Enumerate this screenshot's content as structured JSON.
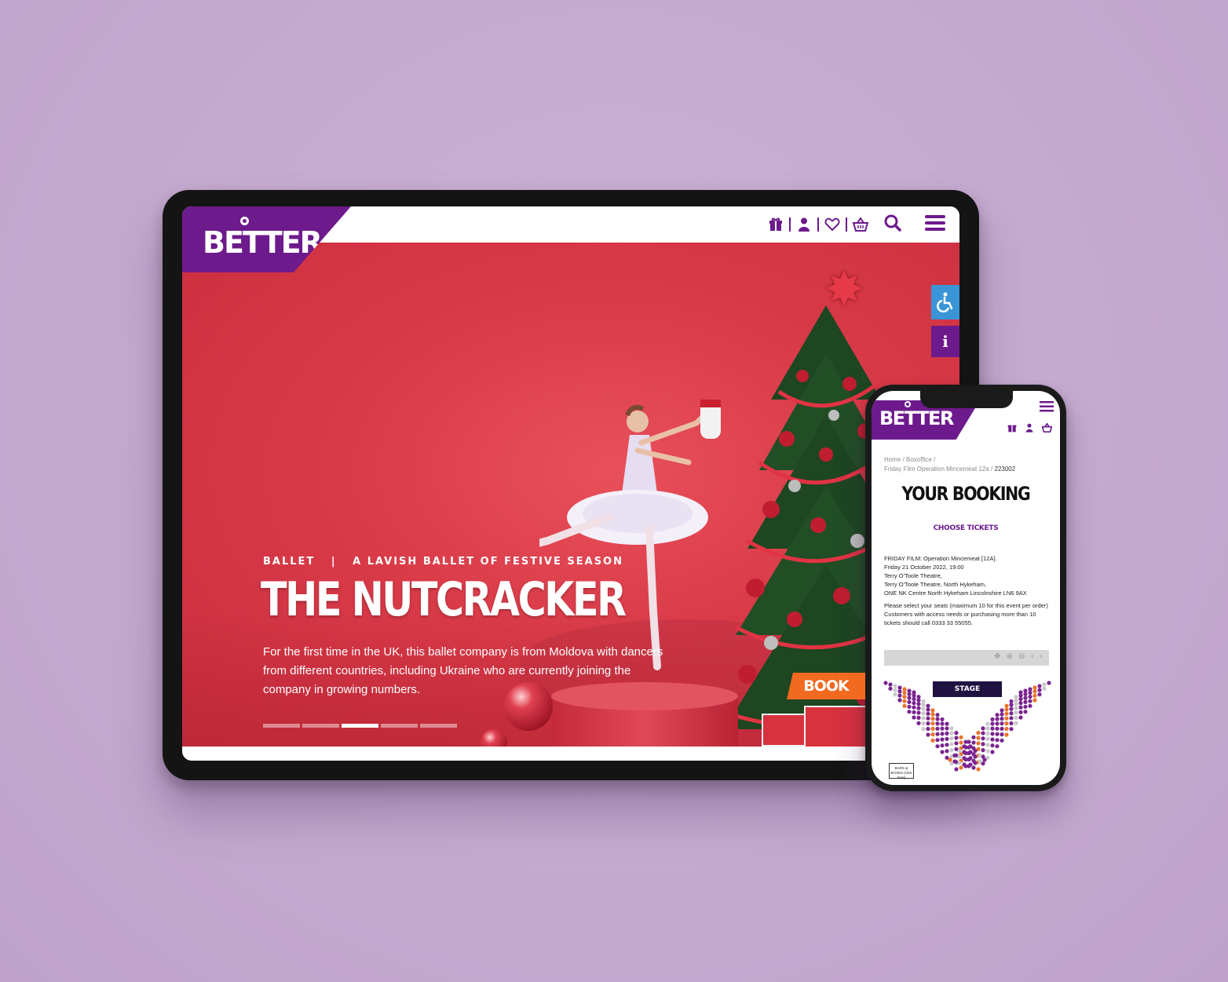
{
  "brand": {
    "name": "BETTER",
    "color": "#6d1a8c"
  },
  "tablet": {
    "header_icons": [
      "gift-icon",
      "user-icon",
      "heart-icon",
      "basket-icon"
    ],
    "search_icon": "search-icon",
    "menu_icon": "hamburger-menu-icon",
    "hero": {
      "category": "BALLET",
      "separator": "|",
      "tagline": "A LAVISH BALLET OF FESTIVE SEASON",
      "title": "THE NUTCRACKER",
      "description": "For the first time in the UK, this ballet company is from Moldova with dancers from different countries, including Ukraine who are currently joining the company in growing numbers.",
      "cta": "BOOK NOW",
      "slide_count": 5,
      "active_slide": 3,
      "accent_cta": "#f26a20",
      "background": "#d93a48"
    },
    "side_buttons": {
      "accessibility_icon": "wheelchair-icon",
      "info_label": "i"
    }
  },
  "phone": {
    "breadcrumbs": {
      "home": "Home",
      "boxoffice": "Boxoffice",
      "event": "Friday Film Operation Mincemeat 12a",
      "current": "223002"
    },
    "title": "YOUR BOOKING",
    "subtitle": "CHOOSE TICKETS",
    "event_lines": [
      "FRIDAY FILM: Operation Mincemeat [12A].",
      "Friday 21 October 2022, 19:00",
      "Terry O'Toole Theatre,",
      "Terry O'Toole Theatre, North Hykeham,",
      "ONE NK Centre North Hykeham Lincolnshire LN6 9AX"
    ],
    "instructions": "Please select your seats (maximum 10 for this event per order)",
    "access_note": "Customers with access needs or purchasing more than 10 tickets should call 0333 33 55055.",
    "stage_label": "STAGE",
    "boxes_label": "BARS & BOXES (click here)"
  }
}
